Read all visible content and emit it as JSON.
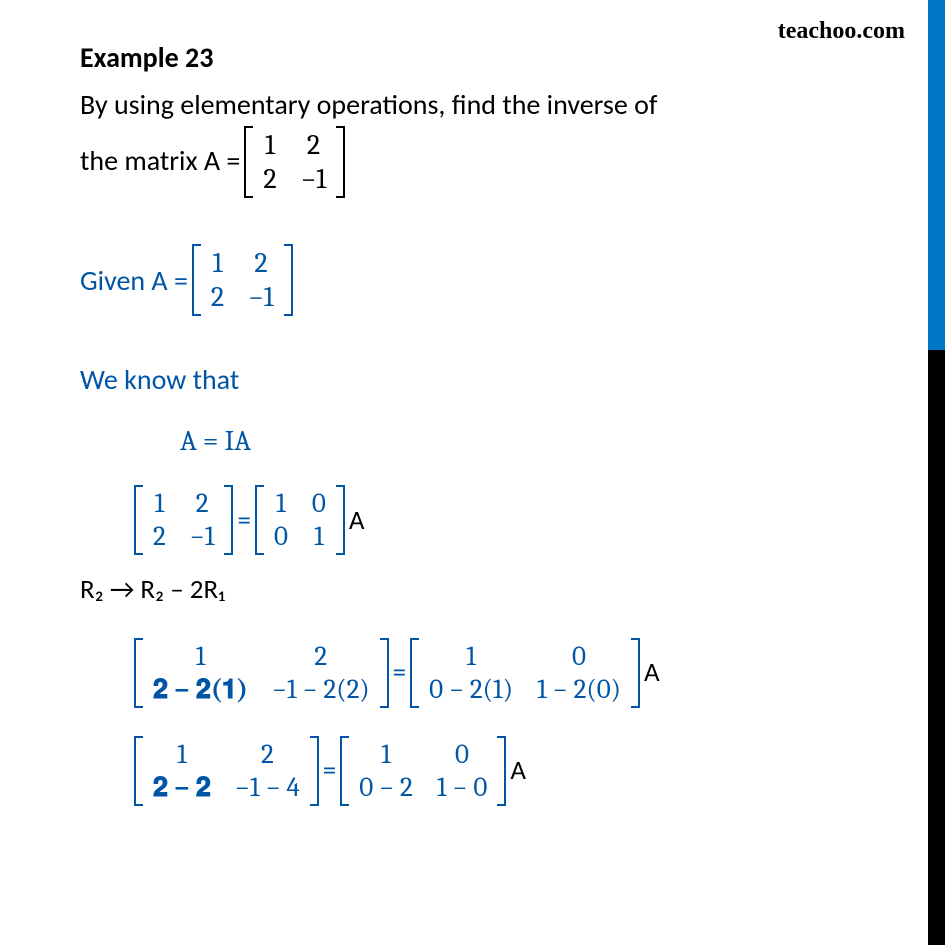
{
  "watermark": "teachoo.com",
  "title": "Example 23",
  "question": {
    "line1": "By using elementary operations, find the inverse of",
    "line2_prefix": "the matrix A = ",
    "matrixA": [
      [
        "1",
        "2"
      ],
      [
        "2",
        "−1"
      ]
    ]
  },
  "given": {
    "prefix": "Given A = ",
    "matrixA": [
      [
        "1",
        "2"
      ],
      [
        "2",
        "−1"
      ]
    ]
  },
  "weknow": "We know that",
  "eqIA": "A = IA",
  "eq1": {
    "left": [
      [
        "1",
        "2"
      ],
      [
        "2",
        "−1"
      ]
    ],
    "sep": " = ",
    "right": [
      [
        "1",
        "0"
      ],
      [
        "0",
        "1"
      ]
    ],
    "suffix": " A"
  },
  "rowop": "R₂ → R₂ – 2R₁",
  "eq2": {
    "left": [
      [
        "1",
        "2"
      ],
      [
        "𝟐 − 𝟐(𝟏)",
        "−1 − 2(2)"
      ]
    ],
    "sep": " = ",
    "right": [
      [
        "1",
        "0"
      ],
      [
        "0 − 2(1)",
        "1 − 2(0)"
      ]
    ],
    "suffix": " A"
  },
  "eq3": {
    "left": [
      [
        "1",
        "2"
      ],
      [
        "𝟐 − 𝟐",
        "−1 − 4"
      ]
    ],
    "sep": " = ",
    "right": [
      [
        "1",
        "0"
      ],
      [
        "0 − 2",
        "1 − 0"
      ]
    ],
    "suffix": " A"
  }
}
